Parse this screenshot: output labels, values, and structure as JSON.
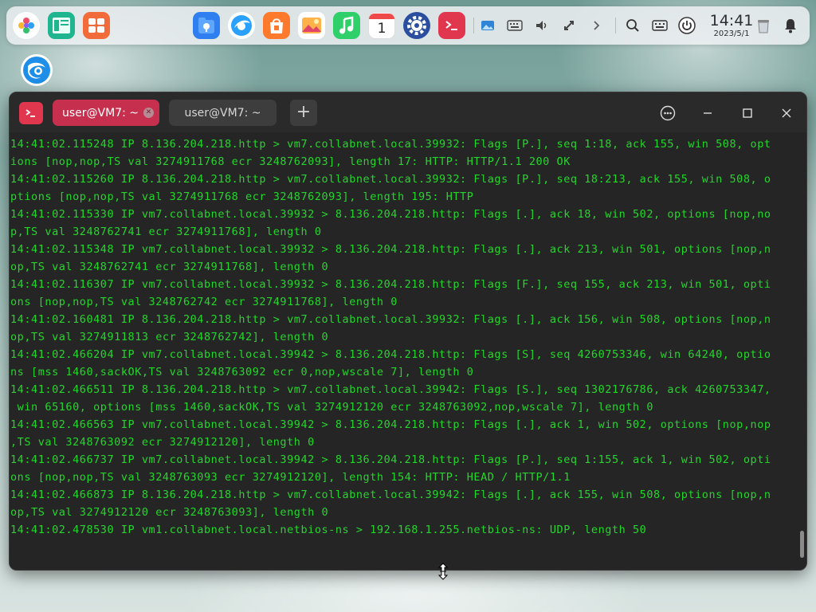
{
  "dock": {
    "apps": [
      {
        "name": "launcher",
        "icon": "launcher-icon"
      },
      {
        "name": "multitasking-view",
        "icon": "multitask-icon"
      },
      {
        "name": "workspace",
        "icon": "workspace-icon"
      },
      {
        "name": "file-manager",
        "icon": "file-manager-icon"
      },
      {
        "name": "browser",
        "icon": "browser-icon"
      },
      {
        "name": "app-store",
        "icon": "app-store-icon"
      },
      {
        "name": "image-viewer",
        "icon": "image-viewer-icon"
      },
      {
        "name": "music",
        "icon": "music-icon"
      },
      {
        "name": "calendar",
        "icon": "calendar-icon",
        "label": "1"
      },
      {
        "name": "control-center",
        "icon": "settings-icon"
      },
      {
        "name": "terminal",
        "icon": "terminal-icon"
      }
    ],
    "tray": [
      "screenshot-icon",
      "keyboard-icon",
      "volume-icon",
      "network-icon",
      "chevron-right-icon",
      "search-icon",
      "input-method-icon",
      "power-icon",
      "trash-icon",
      "notification-icon"
    ],
    "clock": {
      "time": "14:41",
      "date": "2023/5/1"
    }
  },
  "window": {
    "tabs": [
      {
        "label": "user@VM7: ~",
        "active": true
      },
      {
        "label": "user@VM7: ~",
        "active": false
      }
    ],
    "new_tab_label": "+",
    "terminal_lines": [
      "14:41:02.115248 IP 8.136.204.218.http > vm7.collabnet.local.39932: Flags [P.], seq 1:18, ack 155, win 508, opt",
      "ions [nop,nop,TS val 3274911768 ecr 3248762093], length 17: HTTP: HTTP/1.1 200 OK",
      "14:41:02.115260 IP 8.136.204.218.http > vm7.collabnet.local.39932: Flags [P.], seq 18:213, ack 155, win 508, o",
      "ptions [nop,nop,TS val 3274911768 ecr 3248762093], length 195: HTTP",
      "14:41:02.115330 IP vm7.collabnet.local.39932 > 8.136.204.218.http: Flags [.], ack 18, win 502, options [nop,no",
      "p,TS val 3248762741 ecr 3274911768], length 0",
      "14:41:02.115348 IP vm7.collabnet.local.39932 > 8.136.204.218.http: Flags [.], ack 213, win 501, options [nop,n",
      "op,TS val 3248762741 ecr 3274911768], length 0",
      "14:41:02.116307 IP vm7.collabnet.local.39932 > 8.136.204.218.http: Flags [F.], seq 155, ack 213, win 501, opti",
      "ons [nop,nop,TS val 3248762742 ecr 3274911768], length 0",
      "14:41:02.160481 IP 8.136.204.218.http > vm7.collabnet.local.39932: Flags [.], ack 156, win 508, options [nop,n",
      "op,TS val 3274911813 ecr 3248762742], length 0",
      "14:41:02.466204 IP vm7.collabnet.local.39942 > 8.136.204.218.http: Flags [S], seq 4260753346, win 64240, optio",
      "ns [mss 1460,sackOK,TS val 3248763092 ecr 0,nop,wscale 7], length 0",
      "14:41:02.466511 IP 8.136.204.218.http > vm7.collabnet.local.39942: Flags [S.], seq 1302176786, ack 4260753347,",
      " win 65160, options [mss 1460,sackOK,TS val 3274912120 ecr 3248763092,nop,wscale 7], length 0",
      "14:41:02.466563 IP vm7.collabnet.local.39942 > 8.136.204.218.http: Flags [.], ack 1, win 502, options [nop,nop",
      ",TS val 3248763092 ecr 3274912120], length 0",
      "14:41:02.466737 IP vm7.collabnet.local.39942 > 8.136.204.218.http: Flags [P.], seq 1:155, ack 1, win 502, opti",
      "ons [nop,nop,TS val 3248763093 ecr 3274912120], length 154: HTTP: HEAD / HTTP/1.1",
      "14:41:02.466873 IP 8.136.204.218.http > vm7.collabnet.local.39942: Flags [.], ack 155, win 508, options [nop,n",
      "op,TS val 3274912120 ecr 3248763093], length 0",
      "14:41:02.478530 IP vm1.collabnet.local.netbios-ns > 192.168.1.255.netbios-ns: UDP, length 50"
    ]
  },
  "colors": {
    "terminal_text": "#24d62b",
    "terminal_bg": "#252525",
    "active_tab": "#c6304e",
    "terminal_icon": "#e0374f"
  }
}
